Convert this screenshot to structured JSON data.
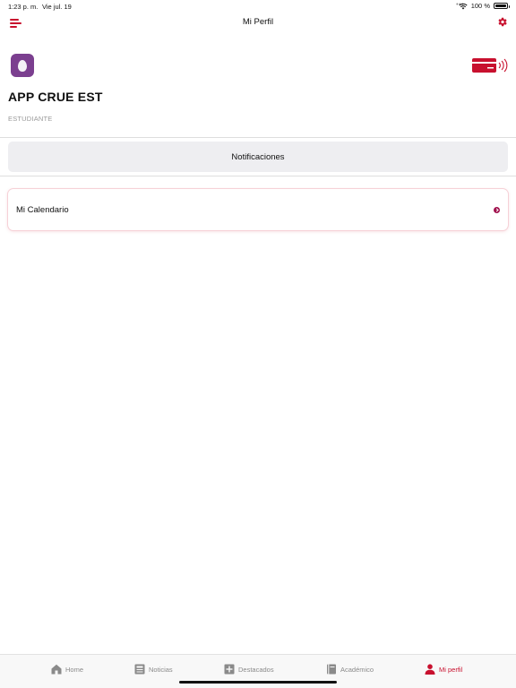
{
  "status_bar": {
    "time": "1:23 p. m.",
    "date": "Vie jul. 19",
    "battery": "100 %",
    "battery_level": 1.0
  },
  "nav": {
    "title": "Mi Perfil",
    "menu_icon": "menu-icon",
    "settings_icon": "gear-icon"
  },
  "profile": {
    "name": "APP CRUE EST",
    "role": "ESTUDIANTE",
    "avatar_icon": "egg-icon",
    "card_icon": "contactless-card-icon"
  },
  "actions": {
    "notifications_label": "Notificaciones"
  },
  "menu": {
    "items": [
      {
        "label": "Mi Calendario",
        "icon": "chevron-right-icon"
      }
    ]
  },
  "tab_bar": {
    "tabs": [
      {
        "label": "Home",
        "icon": "home-icon",
        "active": false
      },
      {
        "label": "Noticias",
        "icon": "news-icon",
        "active": false
      },
      {
        "label": "Destacados",
        "icon": "plus-icon",
        "active": false
      },
      {
        "label": "Académico",
        "icon": "book-icon",
        "active": false
      },
      {
        "label": "Mi perfil",
        "icon": "person-icon",
        "active": true
      }
    ]
  },
  "colors": {
    "accent": "#c8102e",
    "avatar_bg": "#7b3f8f",
    "chevron": "#a0114d",
    "inactive_tab": "#8a8a8a"
  }
}
